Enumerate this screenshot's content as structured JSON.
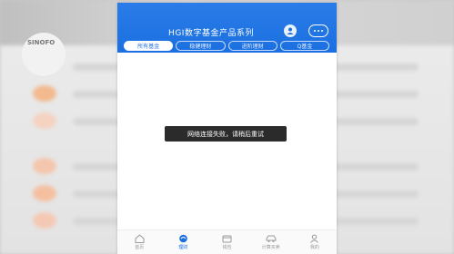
{
  "background": {
    "logo_text": "SINOFO"
  },
  "app": {
    "title": "HGI数字基金产品系列"
  },
  "tabs": [
    {
      "label": "所有基金",
      "active": true
    },
    {
      "label": "稳健理财",
      "active": false
    },
    {
      "label": "进阶理财",
      "active": false
    },
    {
      "label": "Q基金",
      "active": false
    }
  ],
  "toast": {
    "message": "网络连接失败，请稍后重试"
  },
  "tabbar": [
    {
      "label": "首页",
      "icon": "home-icon",
      "active": false
    },
    {
      "label": "理财",
      "icon": "finance-icon",
      "active": true
    },
    {
      "label": "钱包",
      "icon": "wallet-icon",
      "active": false
    },
    {
      "label": "计算买卖",
      "icon": "car-icon",
      "active": false
    },
    {
      "label": "我的",
      "icon": "user-icon",
      "active": false
    }
  ],
  "colors": {
    "primary": "#1b6fe0",
    "toast_bg": "#2b2b2b"
  }
}
